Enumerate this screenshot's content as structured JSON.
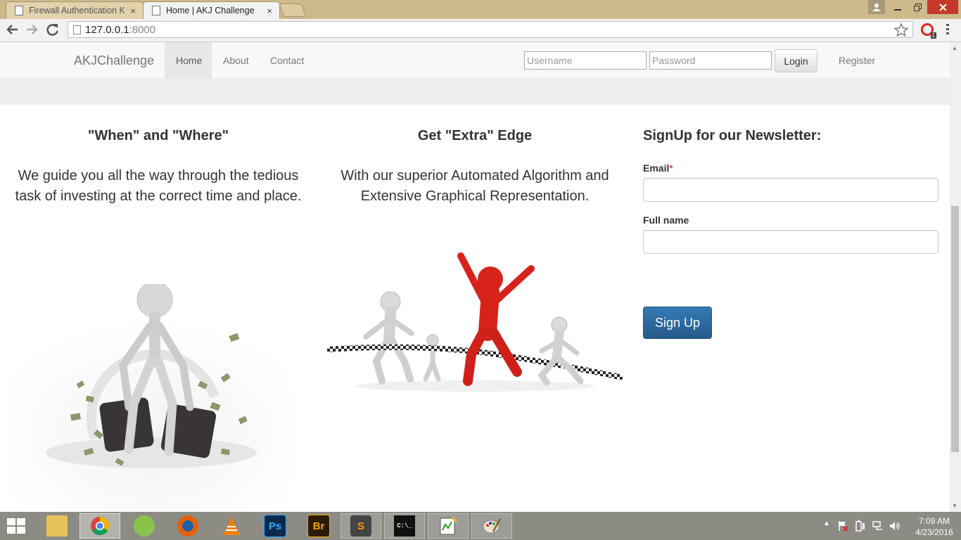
{
  "browser": {
    "tabs": [
      {
        "title": "Firewall Authentication Ke",
        "active": false
      },
      {
        "title": "Home | AKJ Challenge",
        "active": true
      }
    ],
    "close_glyph": "×",
    "url_host": "127.0.0.1",
    "url_port": ":8000",
    "opera_badge": "1"
  },
  "site": {
    "brand": "AKJChallenge",
    "nav": [
      "Home",
      "About",
      "Contact"
    ],
    "username_placeholder": "Username",
    "password_placeholder": "Password",
    "login_label": "Login",
    "register_label": "Register"
  },
  "features": [
    {
      "heading": "\"When\" and \"Where\"",
      "text": "We guide you all the way through the tedious task of investing at the correct time and place."
    },
    {
      "heading": "Get \"Extra\" Edge",
      "text": "With our superior Automated Algorithm and Extensive Graphical Representation."
    }
  ],
  "newsletter": {
    "heading": "SignUp for our Newsletter:",
    "email_label": "Email",
    "required_mark": "*",
    "fullname_label": "Full name",
    "signup_label": "Sign Up"
  },
  "taskbar": {
    "apps": [
      "file-explorer-icon",
      "chrome-icon",
      "android-studio-icon",
      "firefox-icon",
      "vlc-icon",
      "photoshop-icon",
      "bridge-icon",
      "sublime-text-icon",
      "command-prompt-icon",
      "notepad-icon",
      "paint-icon"
    ],
    "ps_label": "Ps",
    "br_label": "Br",
    "sublime_label": "S",
    "cmd_label": "C:\\_",
    "time": "7:09 AM",
    "date": "4/23/2016"
  },
  "colors": {
    "brand_blue": "#337ab7",
    "tabstrip": "#cdb98c",
    "figure_red": "#d8221c"
  }
}
